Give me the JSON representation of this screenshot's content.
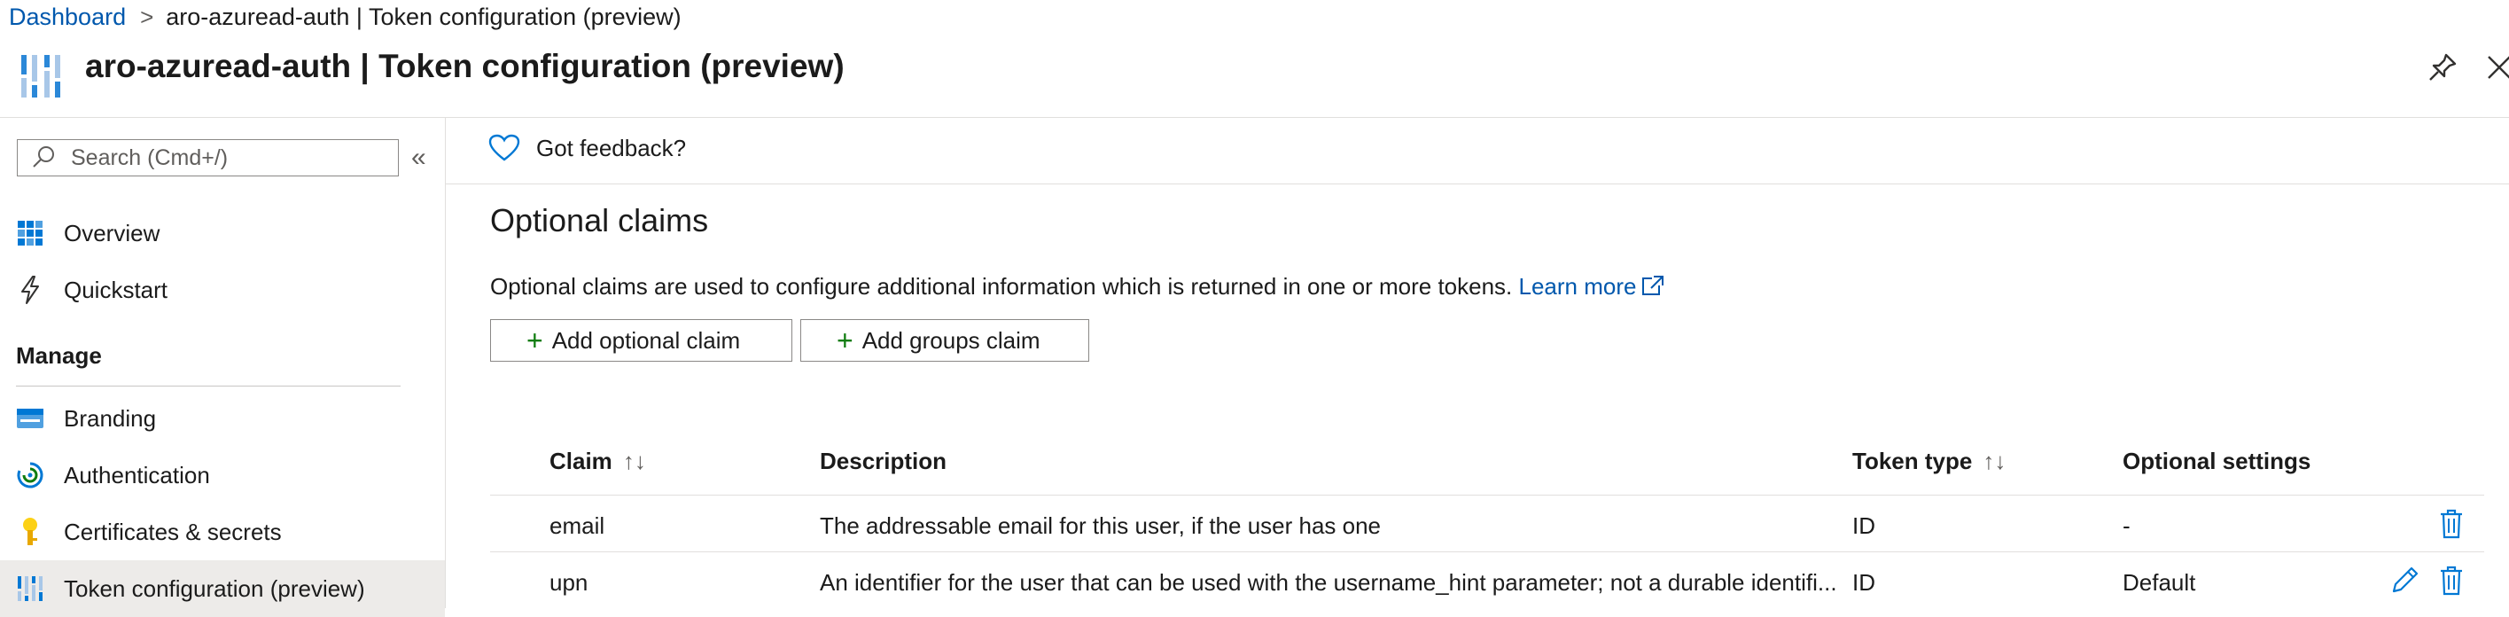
{
  "breadcrumb": {
    "root": "Dashboard",
    "separator": ">",
    "current": "aro-azuread-auth | Token configuration (preview)"
  },
  "header": {
    "title": "aro-azuread-auth | Token configuration (preview)",
    "app_icon": "app-registration-icon",
    "pin_icon": "pin-icon",
    "close_icon": "close-icon"
  },
  "sidebar": {
    "search_placeholder": "Search (Cmd+/)",
    "collapse_glyph": "«",
    "items_top": [
      {
        "label": "Overview",
        "icon": "overview-grid-icon"
      },
      {
        "label": "Quickstart",
        "icon": "lightning-icon"
      }
    ],
    "section": "Manage",
    "items_manage": [
      {
        "label": "Branding",
        "icon": "branding-icon"
      },
      {
        "label": "Authentication",
        "icon": "authentication-icon"
      },
      {
        "label": "Certificates & secrets",
        "icon": "key-icon"
      },
      {
        "label": "Token configuration (preview)",
        "icon": "token-config-icon",
        "selected": true
      }
    ]
  },
  "feedback": {
    "label": "Got feedback?",
    "icon": "heart-icon"
  },
  "main": {
    "heading": "Optional claims",
    "description": "Optional claims are used to configure additional information which is returned in one or more tokens.",
    "learn_more": "Learn more",
    "add_optional_claim": "Add optional claim",
    "add_groups_claim": "Add groups claim",
    "plus_glyph": "+"
  },
  "table": {
    "columns": [
      {
        "label": "Claim",
        "sort": "↑↓"
      },
      {
        "label": "Description"
      },
      {
        "label": "Token type",
        "sort": "↑↓"
      },
      {
        "label": "Optional settings"
      }
    ],
    "rows": [
      {
        "claim": "email",
        "description": "The addressable email for this user, if the user has one",
        "token_type": "ID",
        "settings": "-",
        "editable": false
      },
      {
        "claim": "upn",
        "description": "An identifier for the user that can be used with the username_hint parameter; not a durable identifi...",
        "token_type": "ID",
        "settings": "Default",
        "editable": true
      }
    ]
  },
  "colors": {
    "link": "#0058ad",
    "accent_green": "#107c10",
    "selected_bg": "#edebe9",
    "action_blue": "#0078d4"
  }
}
